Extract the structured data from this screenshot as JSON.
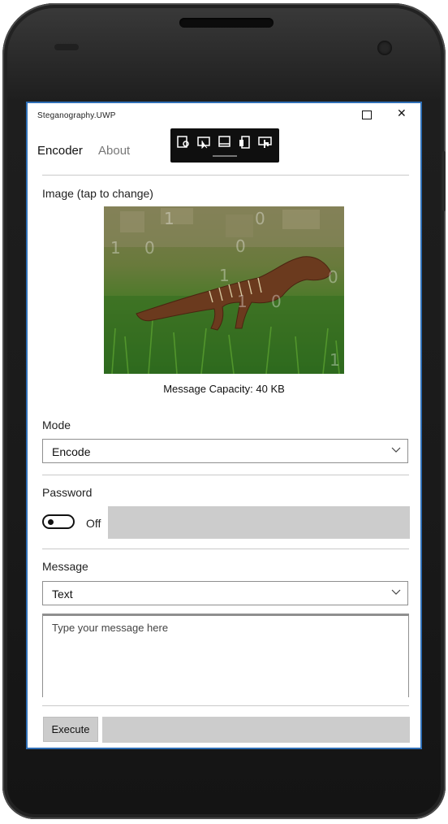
{
  "window": {
    "title": "Steganography.UWP"
  },
  "tabs": [
    {
      "label": "Encoder",
      "active": true
    },
    {
      "label": "About",
      "active": false
    }
  ],
  "toolbar": {
    "icons": [
      "select-region-icon",
      "pointer-select-icon",
      "rectangle-select-icon",
      "device-frame-icon",
      "touch-input-icon"
    ]
  },
  "image_section": {
    "label": "Image (tap to change)",
    "overlay_digits": [
      "1",
      "0",
      "1",
      "0",
      "0",
      "1",
      "0",
      "0",
      "1",
      "1"
    ]
  },
  "capacity": {
    "text": "Message Capacity: 40 KB"
  },
  "mode": {
    "label": "Mode",
    "value": "Encode"
  },
  "password": {
    "label": "Password",
    "toggle_text": "Off",
    "enabled": false
  },
  "message": {
    "label": "Message",
    "type_value": "Text",
    "placeholder": "Type your message here"
  },
  "actions": {
    "execute_label": "Execute"
  }
}
